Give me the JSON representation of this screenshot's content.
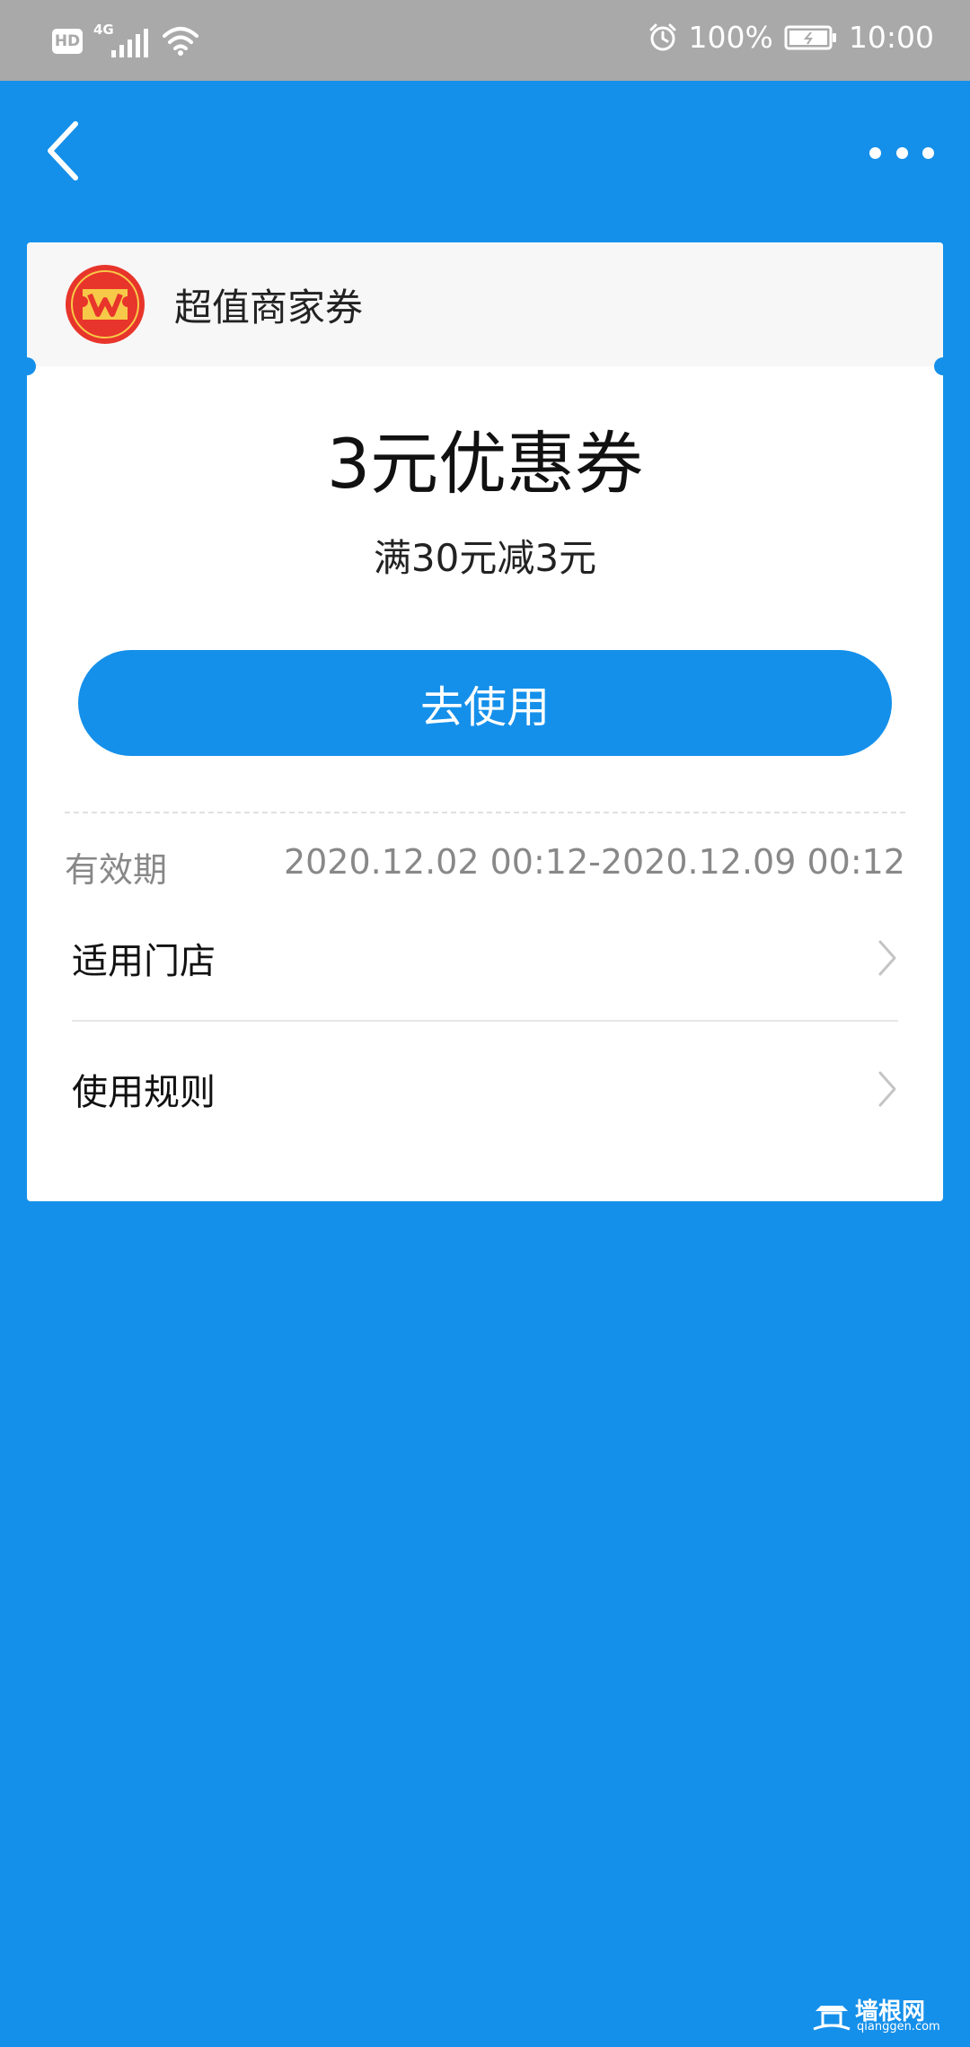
{
  "status_bar": {
    "hd": "HD",
    "network": "4G",
    "battery_percent": "100%",
    "time": "10:00",
    "icons": [
      "hd-badge",
      "signal-icon",
      "wifi-icon",
      "alarm-icon",
      "battery-icon"
    ]
  },
  "nav": {
    "back_icon": "chevron-left-icon",
    "more_icon": "more-dots-icon"
  },
  "merchant": {
    "name": "超值商家券",
    "logo_icon": "merchant-coupon-logo"
  },
  "coupon": {
    "title": "3元优惠券",
    "condition": "满30元减3元",
    "use_button_label": "去使用",
    "validity_label": "有效期",
    "validity_value": "2020.12.02 00:12-2020.12.09 00:12"
  },
  "links": [
    {
      "label": "适用门店"
    },
    {
      "label": "使用规则"
    }
  ],
  "watermark": {
    "title": "墙根网",
    "url": "qianggen.com"
  },
  "colors": {
    "page_background": "#1590ea",
    "status_bar": "#a9a9a9",
    "card": "#ffffff",
    "card_header": "#f7f7f7",
    "button": "#1590ea",
    "logo_red": "#e8352b",
    "logo_yellow": "#f7c948"
  }
}
